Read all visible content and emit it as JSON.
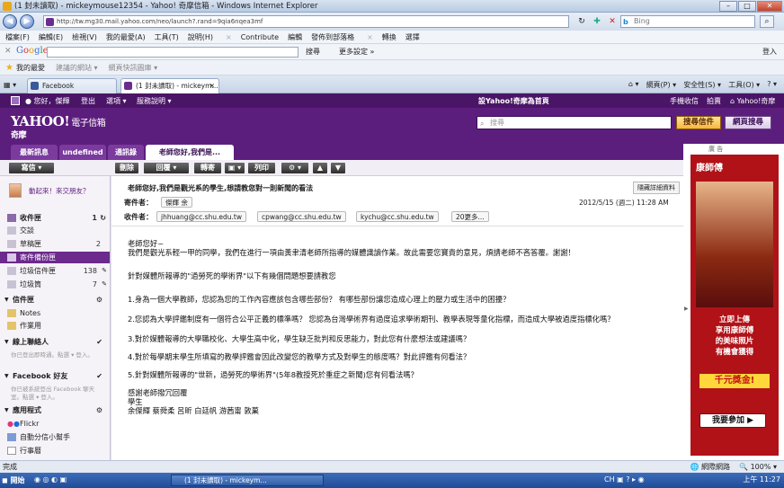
{
  "window": {
    "title": "(1 封未讀取) - mickeymouse12354 - Yahoo! 奇摩信箱 - Windows Internet Explorer"
  },
  "address": {
    "url": "http://tw.mg30.mail.yahoo.com/neo/launch?.rand=9qia6nqea3mf",
    "search_placeholder": "Bing"
  },
  "menubar": {
    "items": [
      "檔案(F)",
      "編輯(E)",
      "檢視(V)",
      "我的最愛(A)",
      "工具(T)",
      "說明(H)"
    ],
    "extras": [
      "Contribute",
      "編輯",
      "發佈到部落格",
      "轉換",
      "選擇"
    ]
  },
  "googlebar": {
    "logo": "Google",
    "search_label": "搜尋",
    "more": "更多設定 »",
    "login": "登入"
  },
  "favorites": {
    "label": "我的最愛",
    "items": [
      "建議的網站 ▾",
      "網頁快訊圖庫 ▾"
    ]
  },
  "ietabs": [
    {
      "label": "Facebook"
    },
    {
      "label": "(1 封未讀取) - mickeym..."
    }
  ],
  "ietools": [
    "網頁(P) ▾",
    "安全性(S) ▾",
    "工具(O) ▾"
  ],
  "ytop": {
    "user": "您好，傑輝",
    "links": [
      "登出",
      "選項 ▾",
      "服務說明 ▾"
    ],
    "home": "設Yahoo!奇摩為首頁",
    "right": [
      "手機收信",
      "拍賣",
      "Yahoo!奇摩"
    ]
  },
  "yahoo": {
    "logo": "YAHOO!",
    "logo_suffix": "電子信箱",
    "sub": "奇摩",
    "search_placeholder": "搜尋",
    "btn_mail": "搜尋信件",
    "btn_web": "網頁搜尋"
  },
  "mailtabs": [
    "最新訊息",
    "undefined",
    "通訊錄",
    "老師您好,我們是..."
  ],
  "toolbar": {
    "new": "寫信",
    "delete": "刪除",
    "reply": "回覆",
    "forward": "轉寄",
    "print": "列印"
  },
  "sidebar": {
    "status": "動起來！來交朋友？",
    "folders": [
      {
        "label": "收件匣",
        "count": "1"
      },
      {
        "label": "交談",
        "count": ""
      },
      {
        "label": "草稿匣",
        "count": "2"
      },
      {
        "label": "寄件備份匣",
        "count": ""
      },
      {
        "label": "垃圾信件匣",
        "count": "138"
      },
      {
        "label": "垃圾筒",
        "count": "7"
      }
    ],
    "mydocs": "信件匣",
    "notes": [
      "Notes",
      "作業用"
    ],
    "online": "線上聯絡人",
    "online_note": "你已登出即時通。點選 ▾ 登入。",
    "facebook": "Facebook 好友",
    "facebook_note": "你已被系統登出 Facebook 聊天室。點選 ▾ 登入。",
    "apps": "應用程式",
    "app_items": [
      "Flickr",
      "自動分信小幫手",
      "行事曆"
    ]
  },
  "email": {
    "subject": "老師您好,我們是觀光系的學生,想請教您對一則新聞的看法",
    "detail_btn": "隱藏詳細資料",
    "from_label": "寄件者：",
    "from": "傑輝 余",
    "to_label": "收件者：",
    "to": [
      "jhhuang@cc.shu.edu.tw",
      "cpwang@cc.shu.edu.tw",
      "kychu@cc.shu.edu.tw"
    ],
    "more": "20更多...",
    "date": "2012/5/15 (週二) 11:28 AM",
    "body": [
      "老師您好~",
      "我們是觀光系輕一甲的同學，我們在進行一項由黃聿清老師所指導的媒體識讀作業。故此需要您寶貴的意見，煩請老師不吝答覆。謝謝！",
      "",
      "針對媒體所報導的\"過勞死的學術界\"以下有幾個問題想要請教您",
      "",
      "1.身為一個大學教師，您認為您的工作內容應該包含哪些部份？ 有哪些部份讓您造成心理上的壓力或生活中的困擾？",
      "",
      "2.您認為大學評鑑制度有一個符合公平正義的標準嗎？ 您認為台灣學術界有過度追求學術期刊、教學表現等量化指標，而造成大學被過度指標化嗎？",
      "",
      "3.對於媒體報導的大學職校化、大學生高中化，學生缺乏批判和反思能力，對此您有什麼想法或建議嗎？",
      "",
      "4.對於每學期末學生所填寫的教學評鑑會因此改變您的教學方式及對學生的態度嗎？對此評鑑有何看法？",
      "",
      "5.針對媒體所報導的\"世新，過勞死的學術界\"(5年8教授死於重症之新聞)您有何看法嗎？",
      "",
      "感謝老師撥冗回覆",
      "學生",
      "余傑輝 蔡舜柔 呂昕 白廷帆 游茜甯 敦菓"
    ]
  },
  "ad": {
    "label": "廣 告",
    "brand": "康師傅",
    "line1": "立即上傳",
    "line2": "享用康師傅",
    "line3": "的美味照片",
    "line4": "有機會獲得",
    "gold": "千元獎金!",
    "join": "我要參加 ▶"
  },
  "status": {
    "left": "完成",
    "zone": "網際網路",
    "zoom": "100%"
  },
  "taskbar": {
    "start": "開始",
    "items": [
      "(1 封未讀取) - mickeym..."
    ],
    "clock": "上午 11:27"
  }
}
